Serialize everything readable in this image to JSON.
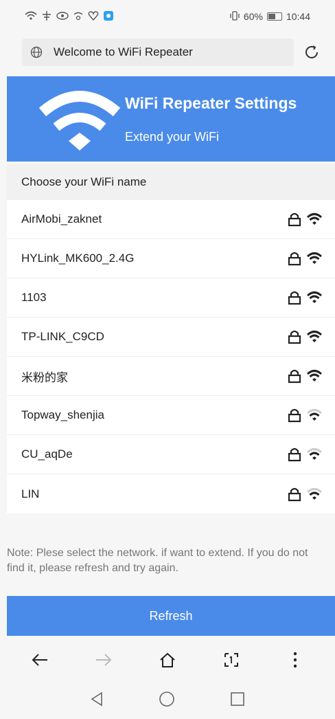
{
  "status_bar": {
    "battery": "60%",
    "time": "10:44"
  },
  "address_bar": {
    "url_text": "Welcome to WiFi Repeater"
  },
  "header": {
    "title": "WiFi Repeater Settings",
    "subtitle": "Extend your WiFi"
  },
  "list": {
    "heading": "Choose your WiFi name",
    "networks": [
      {
        "name": "AirMobi_zaknet",
        "locked": true,
        "signal": "strong"
      },
      {
        "name": "HYLink_MK600_2.4G",
        "locked": true,
        "signal": "strong"
      },
      {
        "name": "1103",
        "locked": true,
        "signal": "strong"
      },
      {
        "name": "TP-LINK_C9CD",
        "locked": true,
        "signal": "strong"
      },
      {
        "name": "米粉的家",
        "locked": true,
        "signal": "strong"
      },
      {
        "name": "Topway_shenjia",
        "locked": true,
        "signal": "weak"
      },
      {
        "name": "CU_aqDe",
        "locked": true,
        "signal": "weak"
      },
      {
        "name": "LIN",
        "locked": true,
        "signal": "weak"
      }
    ]
  },
  "note": "Note: Plese select the network. if want to extend. If you do not find it, please refresh and try again.",
  "refresh_label": "Refresh",
  "colors": {
    "accent": "#4a8bea"
  },
  "icons": {
    "lock": "lock-icon",
    "wifi": "wifi-icon",
    "back": "back-arrow-icon",
    "forward": "forward-arrow-icon",
    "home": "home-icon",
    "tabs": "tabs-icon",
    "menu": "more-vertical-icon"
  }
}
